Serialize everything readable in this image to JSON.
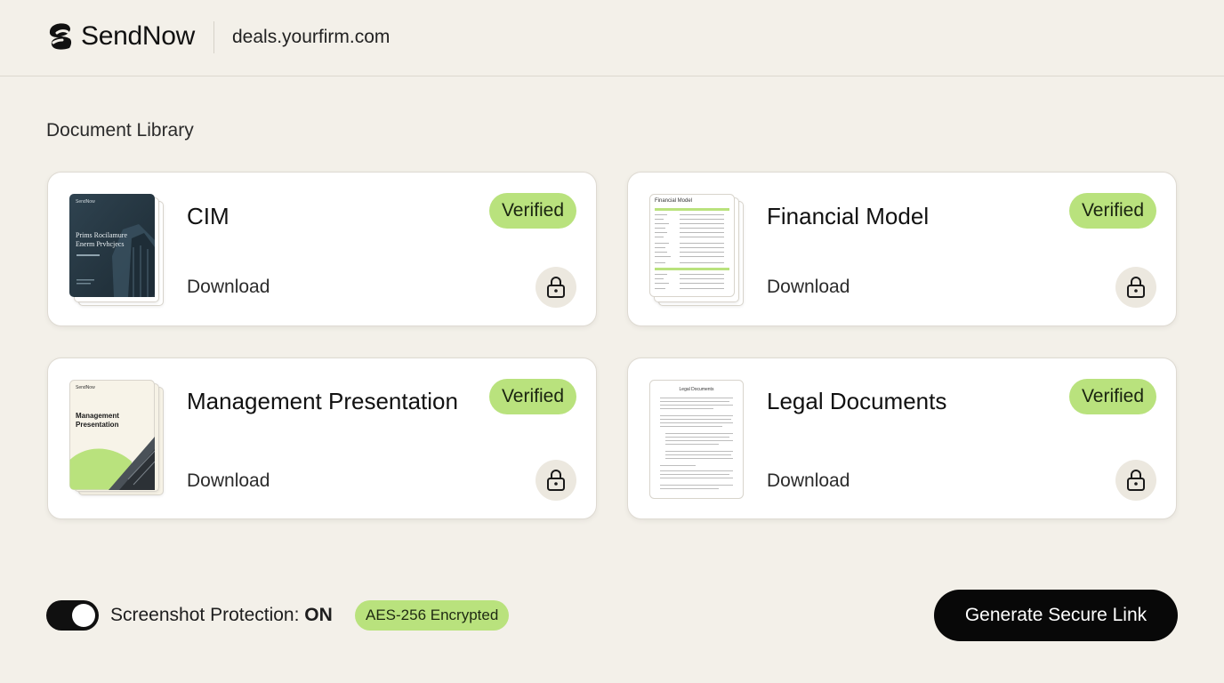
{
  "header": {
    "brand_name": "SendNow",
    "domain": "deals.yourfirm.com"
  },
  "library": {
    "title": "Document Library",
    "cards": [
      {
        "name": "CIM",
        "status": "Verified",
        "download_label": "Download",
        "thumb": {
          "brand": "SendNow",
          "title_line1": "Prims Rocilamure",
          "title_line2": "Enerm Prvhcjecs"
        }
      },
      {
        "name": "Financial Model",
        "status": "Verified",
        "download_label": "Download",
        "thumb": {
          "title": "Financial Model"
        }
      },
      {
        "name": "Management Presentation",
        "status": "Verified",
        "download_label": "Download",
        "thumb": {
          "brand": "SendNow",
          "title_line1": "Management",
          "title_line2": "Presentation"
        }
      },
      {
        "name": "Legal Documents",
        "status": "Verified",
        "download_label": "Download",
        "thumb": {
          "title": "Legal Documents"
        }
      }
    ]
  },
  "footer": {
    "protection_label": "Screenshot Protection:",
    "protection_state": "ON",
    "toggle_on": true,
    "encryption_badge": "AES-256 Encrypted",
    "generate_button": "Generate Secure Link"
  },
  "colors": {
    "background": "#f3f0e9",
    "accent_green": "#b9e27d",
    "button_dark": "#080808",
    "lock_bg": "#ece8df"
  },
  "icons": {
    "brand": "sendnow-logo-icon",
    "lock": "lock-icon"
  }
}
